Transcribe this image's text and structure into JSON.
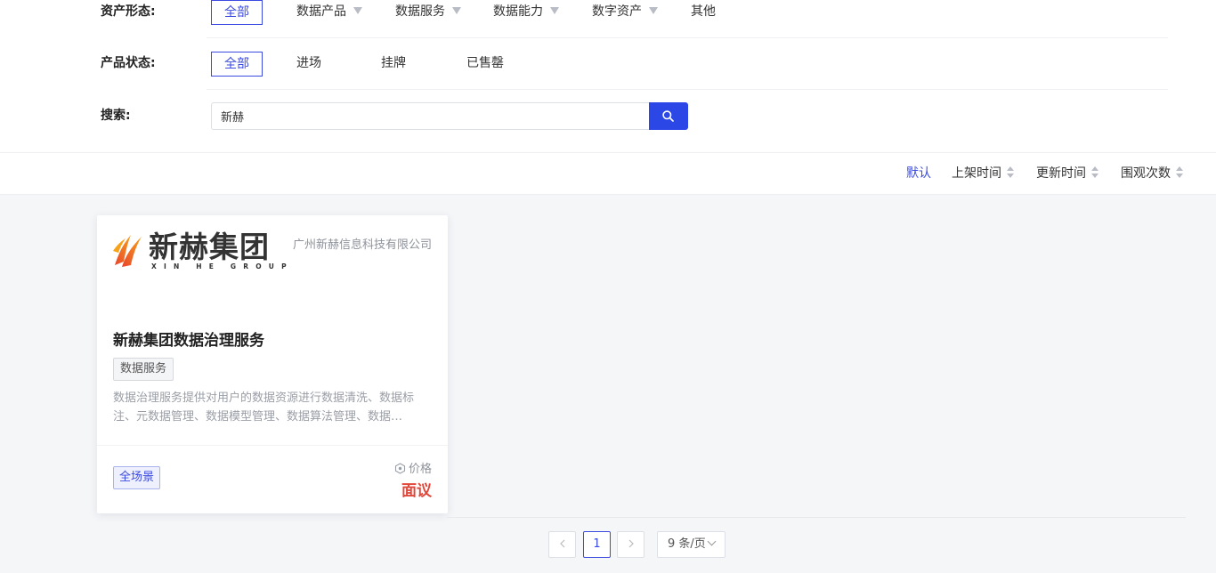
{
  "filters": {
    "asset_form": {
      "label": "资产形态:",
      "options": [
        {
          "label": "全部",
          "active": true
        },
        {
          "label": "数据产品",
          "dropdown": true
        },
        {
          "label": "数据服务",
          "dropdown": true
        },
        {
          "label": "数据能力",
          "dropdown": true
        },
        {
          "label": "数字资产",
          "dropdown": true
        },
        {
          "label": "其他"
        }
      ]
    },
    "product_status": {
      "label": "产品状态:",
      "options": [
        {
          "label": "全部",
          "active": true
        },
        {
          "label": "进场"
        },
        {
          "label": "挂牌"
        },
        {
          "label": "已售罄"
        }
      ]
    },
    "search": {
      "label": "搜索:",
      "value": "新赫",
      "icon": "search-icon"
    }
  },
  "sort": {
    "active_color": "#3b4ae0",
    "items": [
      {
        "label": "默认",
        "active": true
      },
      {
        "label": "上架时间"
      },
      {
        "label": "更新时间"
      },
      {
        "label": "围观次数"
      }
    ]
  },
  "products": [
    {
      "logo": {
        "text_cn": "新赫集团",
        "text_en": "XIN HE GROUP"
      },
      "company": "广州新赫信息科技有限公司",
      "title": "新赫集团数据治理服务",
      "category_tag": "数据服务",
      "description": "数据治理服务提供对用户的数据资源进行数据清洗、数据标注、元数据管理、数据模型管理、数据算法管理、数据…",
      "scene_tag": "全场景",
      "price_label": "价格",
      "price_value": "面议",
      "price_color": "#e0463a"
    }
  ],
  "pagination": {
    "prev_icon": "chevron-left-icon",
    "current_page": "1",
    "next_icon": "chevron-right-icon",
    "page_size": "9 条/页"
  }
}
